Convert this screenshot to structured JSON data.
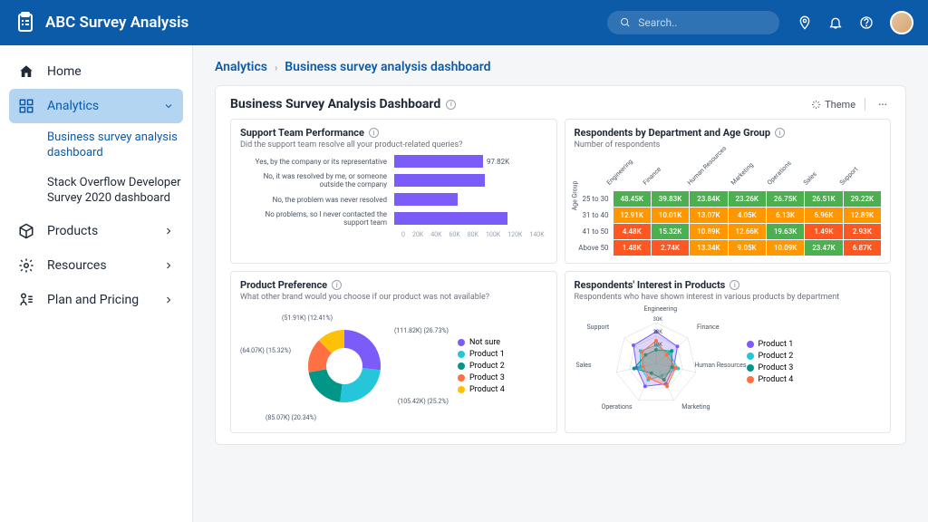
{
  "header": {
    "app_title": "ABC Survey Analysis",
    "search_placeholder": "Search.."
  },
  "sidebar": {
    "items": [
      {
        "label": "Home"
      },
      {
        "label": "Analytics"
      },
      {
        "label": "Products"
      },
      {
        "label": "Resources"
      },
      {
        "label": "Plan and Pricing"
      }
    ],
    "sub_items": [
      {
        "label": "Business survey analysis dashboard"
      },
      {
        "label": "Stack Overflow Developer Survey 2020 dashboard"
      }
    ]
  },
  "breadcrumb": {
    "parent": "Analytics",
    "current": "Business survey analysis dashboard"
  },
  "dashboard": {
    "title": "Business Survey Analysis Dashboard",
    "theme_label": "Theme"
  },
  "panels": {
    "support": {
      "title": "Support Team Performance",
      "subtitle": "Did the support team resolve all your product-related queries?",
      "callout": "97.82K"
    },
    "heatmap": {
      "title": "Respondents by Department and Age Group",
      "subtitle": "Number of respondents"
    },
    "preference": {
      "title": "Product Preference",
      "subtitle": "What other brand would you choose if our product was not available?"
    },
    "interest": {
      "title": "Respondents' Interest in Products",
      "subtitle": "Respondents who have shown interest in various products by department"
    }
  },
  "chart_data": [
    {
      "type": "bar",
      "orientation": "horizontal",
      "title": "Support Team Performance",
      "categories": [
        "Yes, by the company or its representative",
        "No, it was resolved by me, or someone outside the company",
        "No, the problem was never resolved",
        "No problems, so I never contacted the support team"
      ],
      "values": [
        97.82,
        100,
        70,
        125
      ],
      "value_labels": [
        "97.82K",
        "",
        "",
        ""
      ],
      "xlabel": "",
      "x_ticks": [
        "0",
        "20K",
        "40K",
        "60K",
        "80K",
        "100K",
        "120K",
        "140K"
      ],
      "xlim": [
        0,
        140
      ]
    },
    {
      "type": "heatmap",
      "title": "Respondents by Department and Age Group",
      "y_axis_label": "Age Group",
      "rows": [
        "25 to 30",
        "31 to 40",
        "41 to 50",
        "Above 50"
      ],
      "cols": [
        "Engineering",
        "Finance",
        "Human Resources",
        "Marketing",
        "Operations",
        "Sales",
        "Support"
      ],
      "values": [
        [
          "48.45K",
          "39.83K",
          "23.84K",
          "23.26K",
          "26.75K",
          "26.51K",
          "29.22K"
        ],
        [
          "12.91K",
          "10.01K",
          "13.07K",
          "4.05K",
          "6.13K",
          "6.96K",
          "12.89K"
        ],
        [
          "4.48K",
          "15.32K",
          "10.89K",
          "12.66K",
          "19.63K",
          "1.49K",
          "2.93K"
        ],
        [
          "1.48K",
          "2.74K",
          "13.34K",
          "9.05K",
          "10.09K",
          "23.47K",
          "6.87K"
        ]
      ],
      "colors": [
        [
          "#4caf50",
          "#4caf50",
          "#4caf50",
          "#4caf50",
          "#4caf50",
          "#4caf50",
          "#4caf50"
        ],
        [
          "#ff9800",
          "#ff9800",
          "#ff9800",
          "#ff9800",
          "#ff9800",
          "#ff9800",
          "#ff9800"
        ],
        [
          "#ff5722",
          "#4caf50",
          "#ff9800",
          "#ff9800",
          "#4caf50",
          "#ff5722",
          "#ff5722"
        ],
        [
          "#ff5722",
          "#ff5722",
          "#ff9800",
          "#ff9800",
          "#ff9800",
          "#4caf50",
          "#ff5722"
        ]
      ]
    },
    {
      "type": "pie",
      "title": "Product Preference",
      "series": [
        {
          "name": "Not sure",
          "value": 111.82,
          "pct": 26.73,
          "label": "(111.82K) (26.73%)",
          "color": "#7c5cf8"
        },
        {
          "name": "Product 1",
          "value": 105.42,
          "pct": 25.2,
          "label": "(105.42K) (25.2%)",
          "color": "#26c6da"
        },
        {
          "name": "Product 2",
          "value": 85.07,
          "pct": 20.34,
          "label": "(85.07K) (20.34%)",
          "color": "#009688"
        },
        {
          "name": "Product 3",
          "value": 64.07,
          "pct": 15.32,
          "label": "(64.07K) (15.32%)",
          "color": "#ff7043"
        },
        {
          "name": "Product 4",
          "value": 51.91,
          "pct": 12.41,
          "label": "(51.91K) (12.41%)",
          "color": "#ffc107"
        }
      ],
      "legend": [
        "Not sure",
        "Product 1",
        "Product 2",
        "Product 3",
        "Product 4"
      ]
    },
    {
      "type": "radar",
      "title": "Respondents' Interest in Products",
      "axes": [
        "Engineering",
        "Finance",
        "Human Resources",
        "Marketing",
        "Operations",
        "Sales",
        "Support"
      ],
      "ticks": [
        "10K",
        "20K",
        "30K"
      ],
      "series": [
        {
          "name": "Product 1",
          "color": "#7c5cf8"
        },
        {
          "name": "Product 2",
          "color": "#26c6da"
        },
        {
          "name": "Product 3",
          "color": "#009688"
        },
        {
          "name": "Product 4",
          "color": "#ff7043"
        }
      ],
      "legend": [
        "Product 1",
        "Product 2",
        "Product 3",
        "Product 4"
      ]
    }
  ]
}
